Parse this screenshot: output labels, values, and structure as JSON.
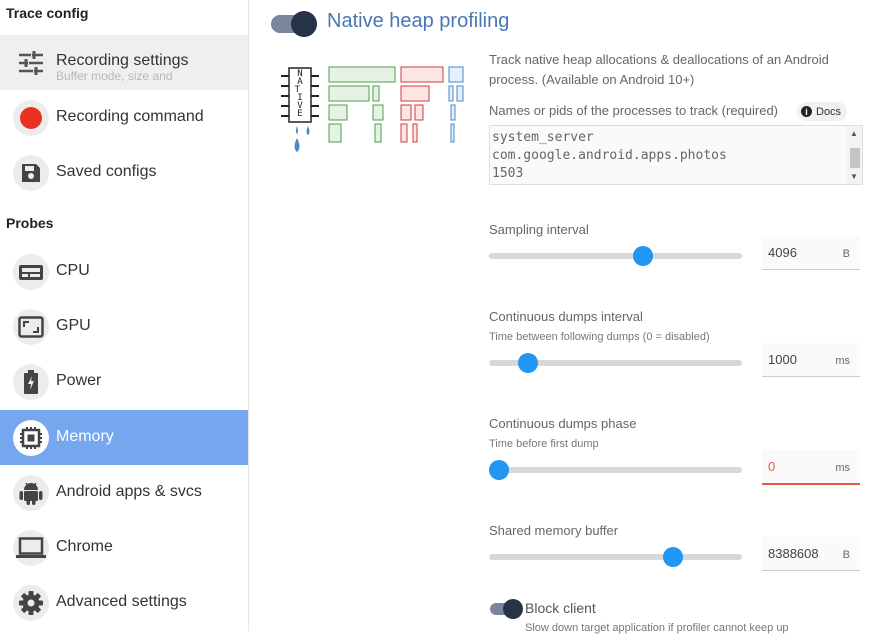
{
  "sidebar": {
    "trace_config_title": "Trace config",
    "probes_title": "Probes",
    "items": [
      {
        "label": "Recording settings",
        "sub": "Buffer mode, size and duration",
        "icon": "tune-icon"
      },
      {
        "label": "Recording command",
        "icon": "record-icon"
      },
      {
        "label": "Saved configs",
        "icon": "save-icon"
      },
      {
        "label": "CPU",
        "icon": "cpu-icon"
      },
      {
        "label": "GPU",
        "icon": "gpu-icon"
      },
      {
        "label": "Power",
        "icon": "battery-icon"
      },
      {
        "label": "Memory",
        "icon": "memory-icon"
      },
      {
        "label": "Android apps & svcs",
        "icon": "android-icon"
      },
      {
        "label": "Chrome",
        "icon": "laptop-icon"
      },
      {
        "label": "Advanced settings",
        "icon": "gear-icon"
      }
    ]
  },
  "main": {
    "title": "Native heap profiling",
    "enabled": true,
    "illustration_text": "NATIVE",
    "description": "Track native heap allocations & deallocations of an Android process. (Available on Android 10+)",
    "process_label": "Names or pids of the processes to track (required)",
    "docs_label": "Docs",
    "processes": [
      "system_server",
      "com.google.android.apps.photos",
      "1503"
    ],
    "sampling": {
      "label": "Sampling interval",
      "value": "4096",
      "unit": "B",
      "position": 0.62
    },
    "dumps_interval": {
      "label": "Continuous dumps interval",
      "hint": "Time between following dumps (0 = disabled)",
      "value": "1000",
      "unit": "ms",
      "position": 0.15
    },
    "dumps_phase": {
      "label": "Continuous dumps phase",
      "hint": "Time before first dump",
      "value": "0",
      "unit": "ms",
      "position": 0.0
    },
    "shm_buffer": {
      "label": "Shared memory buffer",
      "value": "8388608",
      "unit": "B",
      "position": 0.73
    },
    "block_client": {
      "label": "Block client",
      "hint": "Slow down target application if profiler cannot keep up",
      "enabled": true
    }
  },
  "colors": {
    "accent": "#2196f3",
    "active_nav": "#76a7ee",
    "title": "#4a77b4",
    "error": "#e05d44"
  }
}
